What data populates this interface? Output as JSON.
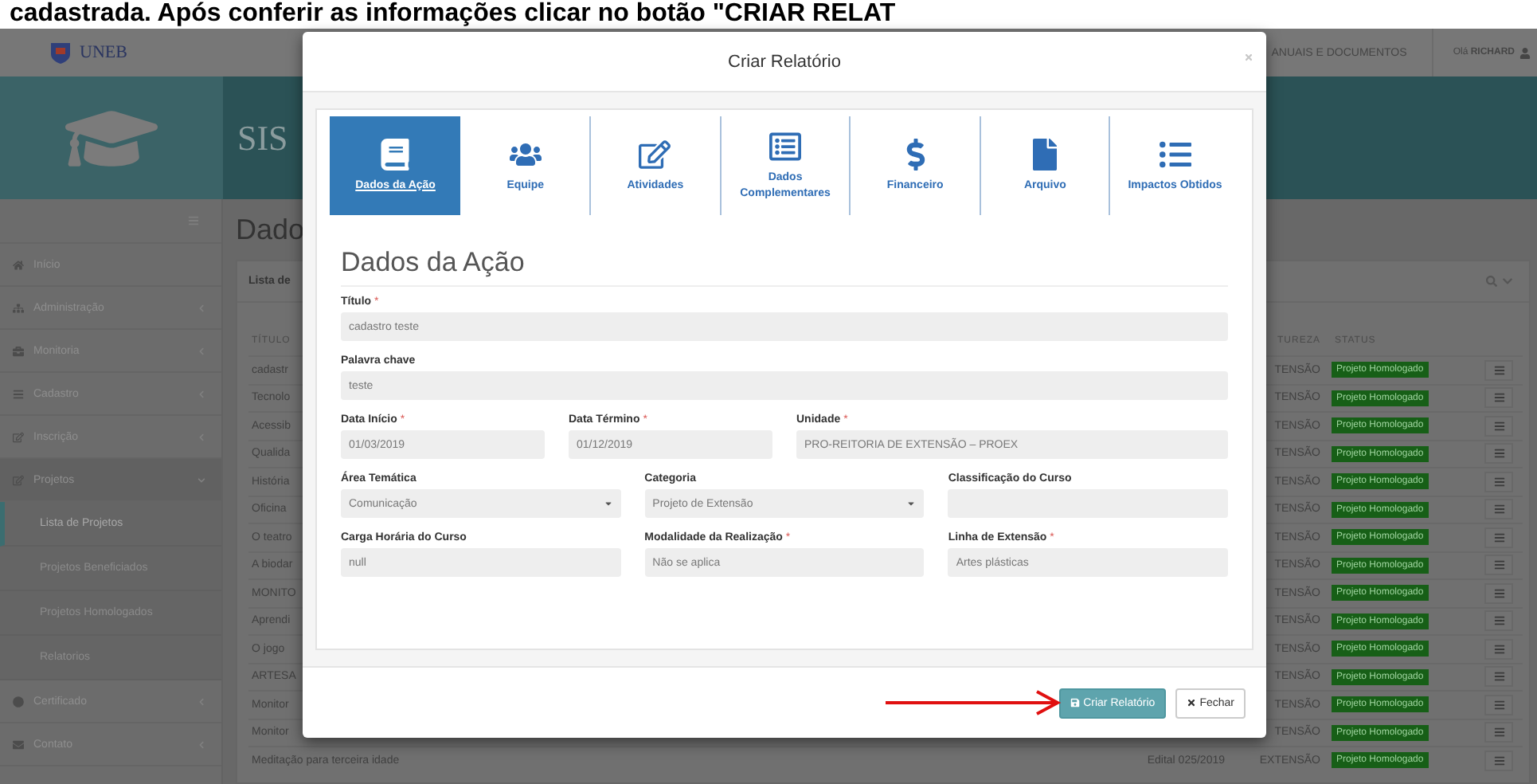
{
  "caption": "cadastrada. Após conferir as informações clicar no botão \"CRIAR RELAT",
  "topbar": {
    "logo_text": "UNEB",
    "menu_link": "ANUAIS E DOCUMENTOS",
    "greeting": "Olá **RICHARD**"
  },
  "banner": {
    "title": "SIS"
  },
  "sidebar": {
    "items": [
      {
        "label": "Início"
      },
      {
        "label": "Administração",
        "expanded": false
      },
      {
        "label": "Monitoria",
        "expanded": false
      },
      {
        "label": "Cadastro",
        "expanded": false
      },
      {
        "label": "Inscrição",
        "expanded": false
      },
      {
        "label": "Projetos",
        "expanded": true,
        "children": [
          {
            "label": "Lista de Projetos",
            "selected": true
          },
          {
            "label": "Projetos Beneficiados",
            "selected": false
          },
          {
            "label": "Projetos Homologados",
            "selected": false
          },
          {
            "label": "Relatorios",
            "selected": false
          }
        ]
      },
      {
        "label": "Certificado",
        "expanded": false
      },
      {
        "label": "Contato",
        "expanded": false
      }
    ]
  },
  "page": {
    "title": "Dado",
    "panel_title": "Lista de",
    "table": {
      "columns": [
        "TÍTULO",
        "TUREZA",
        "STATUS"
      ],
      "rows": [
        {
          "title": "cadastr",
          "nature": "TENSÃO",
          "status": "Projeto Homologado"
        },
        {
          "title": "Tecnolo",
          "nature": "TENSÃO",
          "status": "Projeto Homologado"
        },
        {
          "title": "Acessib",
          "nature": "TENSÃO",
          "status": "Projeto Homologado"
        },
        {
          "title": "Qualida",
          "nature": "TENSÃO",
          "status": "Projeto Homologado"
        },
        {
          "title": "História",
          "nature": "TENSÃO",
          "status": "Projeto Homologado"
        },
        {
          "title": "Oficina",
          "nature": "TENSÃO",
          "status": "Projeto Homologado"
        },
        {
          "title": "O teatro",
          "nature": "TENSÃO",
          "status": "Projeto Homologado"
        },
        {
          "title": "A biodar",
          "nature": "TENSÃO",
          "status": "Projeto Homologado"
        },
        {
          "title": "MONITO",
          "nature": "TENSÃO",
          "status": "Projeto Homologado"
        },
        {
          "title": "Aprendi",
          "nature": "TENSÃO",
          "status": "Projeto Homologado"
        },
        {
          "title": "O jogo",
          "nature": "TENSÃO",
          "status": "Projeto Homologado"
        },
        {
          "title": "ARTESA",
          "nature": "TENSÃO",
          "status": "Projeto Homologado"
        },
        {
          "title": "Monitor",
          "nature": "TENSÃO",
          "status": "Projeto Homologado"
        },
        {
          "title": "Monitor",
          "nature": "TENSÃO",
          "status": "Projeto Homologado"
        },
        {
          "title": "Meditação para terceira idade",
          "edital": "Edital 025/2019",
          "nature": "EXTENSÃO",
          "status": "Projeto Homologado"
        }
      ]
    }
  },
  "modal": {
    "title": "Criar Relatório",
    "tabs": [
      {
        "label": "Dados da Ação",
        "selected": true
      },
      {
        "label": "Equipe",
        "selected": false
      },
      {
        "label": "Atividades",
        "selected": false
      },
      {
        "label": "Dados Complementares",
        "selected": false
      },
      {
        "label": "Financeiro",
        "selected": false
      },
      {
        "label": "Arquivo",
        "selected": false
      },
      {
        "label": "Impactos Obtidos",
        "selected": false
      }
    ],
    "section_title": "Dados da Ação",
    "rows": [
      [
        {
          "label": "Título",
          "required_mark": "*",
          "kind": "text",
          "value": "cadastro teste"
        }
      ],
      [
        {
          "label": "Palavra chave",
          "kind": "text",
          "value": "teste"
        }
      ],
      [
        {
          "kind": "pair",
          "fields": [
            {
              "label": "Data Início",
              "required_mark": "*",
              "kind": "date",
              "value": "01/03/2019"
            },
            {
              "label": "Data Término",
              "required_mark": "*",
              "kind": "date",
              "value": "01/12/2019"
            }
          ]
        },
        {
          "label": "Unidade",
          "required_mark": "*",
          "kind": "text",
          "value": "PRO-REITORIA DE EXTENSÃO – PROEX"
        }
      ],
      [
        {
          "label": "Área Temática",
          "kind": "select",
          "value": "Comunicação"
        },
        {
          "label": "Categoria",
          "kind": "select",
          "value": "Projeto de Extensão"
        },
        {
          "label": "Classificação do Curso",
          "kind": "text"
        }
      ],
      [
        {
          "label": "Carga Horária do Curso",
          "kind": "text",
          "value": "null"
        },
        {
          "label": "Modalidade da Realização",
          "required_mark": "*",
          "kind": "text",
          "value": "Não se aplica"
        },
        {
          "label": "Linha de Extensão",
          "required_mark": "*",
          "kind": "text",
          "value": "Artes plásticas"
        }
      ]
    ],
    "buttons": [
      {
        "label": "Criar Relatório",
        "kind": "primary"
      },
      {
        "label": "Fechar",
        "kind": "default"
      }
    ]
  }
}
